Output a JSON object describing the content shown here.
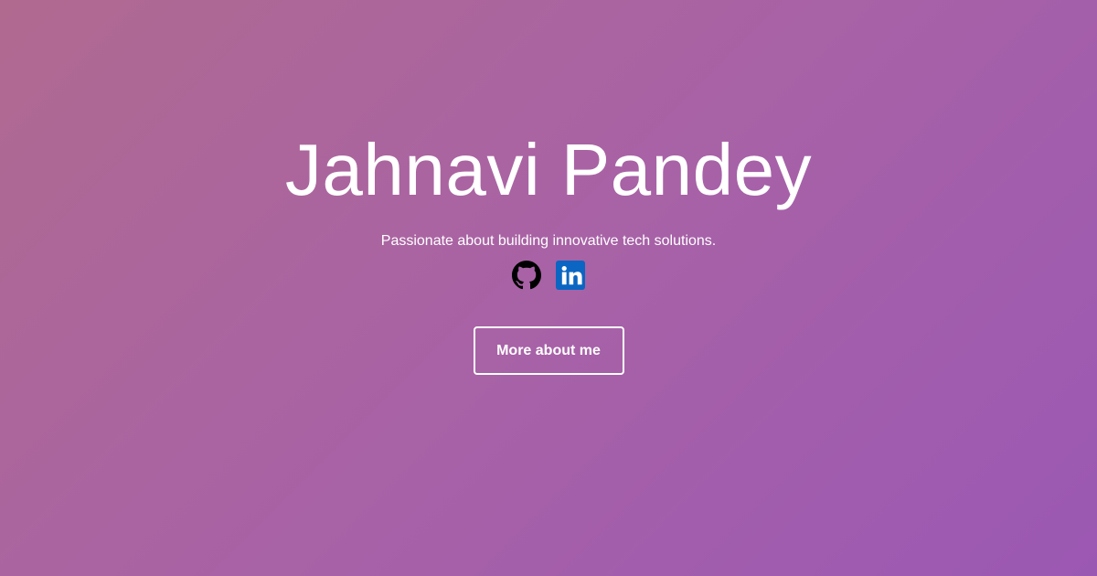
{
  "hero": {
    "name": "Jahnavi Pandey",
    "tagline": "Passionate about building innovative tech solutions.",
    "cta_label": "More about me"
  },
  "social": [
    {
      "icon": "github-icon",
      "color": "#000000"
    },
    {
      "icon": "linkedin-icon",
      "color": "#0a66c2"
    }
  ],
  "colors": {
    "gradient_start": "#b06a90",
    "gradient_end": "#9b58b3",
    "text": "#ffffff"
  }
}
